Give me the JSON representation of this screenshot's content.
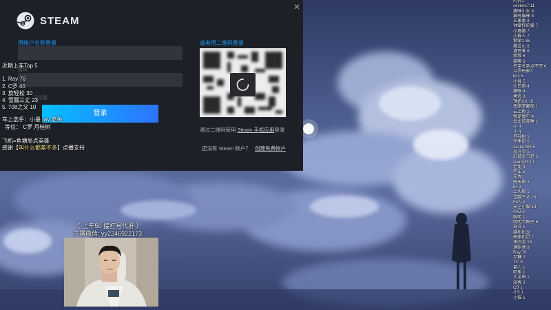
{
  "steam": {
    "logo_text": "STEAM",
    "account_label": "用帐户名称登录",
    "qr_label": "或者用二维码登录",
    "password_label_faded": "密码",
    "remember_label_faded": "记住我",
    "login_button": "登录",
    "qr_hint_prefix": "通过二维码使用 ",
    "qr_hint_link": "Steam 手机应用",
    "qr_hint_suffix": "登录",
    "no_account_text": "还没有 Steam 帐户？",
    "create_account_link": "创建免费帐户",
    "close_glyph": "✕"
  },
  "overlay": {
    "top5_title": "近期上车Top 5",
    "top5": [
      "1.  Ray 76",
      "2.  C罗 40",
      "3.  旋轻松 30",
      "4.  雪瓢三丈 23",
      "5.  708之父 10"
    ],
    "riders_line": "车上选手：小墨 ray 老兔",
    "rank_line": "等位：  C罗 月桂树",
    "plane_line": "飞机=鱼塘局点英雄",
    "thanks_prefix": "感谢【",
    "thanks_highlight": "叫什么都差不多",
    "thanks_suffix": "】点播支持",
    "wechat_line1": "（ 上车50 接打号代肝 ）",
    "wechat_line2": "主播微信: yy2246922173"
  },
  "ticker": [
    "阿狗1",
    "sevens7 11",
    "猫咪小水 8",
    "猫有猫神 8",
    "芒果蛋 8",
    "钟爱你的爱 7",
    "小鹿路 7",
    "小猫人 7",
    "繁荣1 36",
    "猫逗火 6",
    "灌鸡乖 6",
    "牧歌 6",
    "猫嘟 6",
    "名字长到点不完 6",
    "斗罗玩家3",
    "kns 5",
    "小骨 5",
    "大白狼 4",
    "猫眼 4",
    "烤鸡 3",
    "顶奶XX 19",
    "无路求翻船 1",
    "云上桃 2",
    "我是微牛 4",
    "武士放弃睡 2",
    "小 4",
    "不 4",
    "月桂树 1",
    "冬季是 6",
    "xavier008 5",
    "海洋凉 5",
    "旧城念书是 2",
    "swing353 1",
    "老兔 4",
    "老王 6",
    "无忧",
    "雨天酷 3",
    "bs 3",
    "上头帽 1",
    "雪瓢三丈 23",
    "FAN 4",
    "天空小脚 19",
    "4AB 3",
    "聪明 1",
    "明明大概子 6",
    "海洋 1",
    "猫松松30",
    "高原机灵 7",
    "夜间龙 14",
    "满厨师 9",
    "Ray 76",
    "又糖 2",
    "YC 8",
    "菊心 1",
    "阿瓶 1",
    "大龙鱼 1",
    "海客 2",
    "CB 1",
    "小5 1",
    "小猫 1"
  ]
}
